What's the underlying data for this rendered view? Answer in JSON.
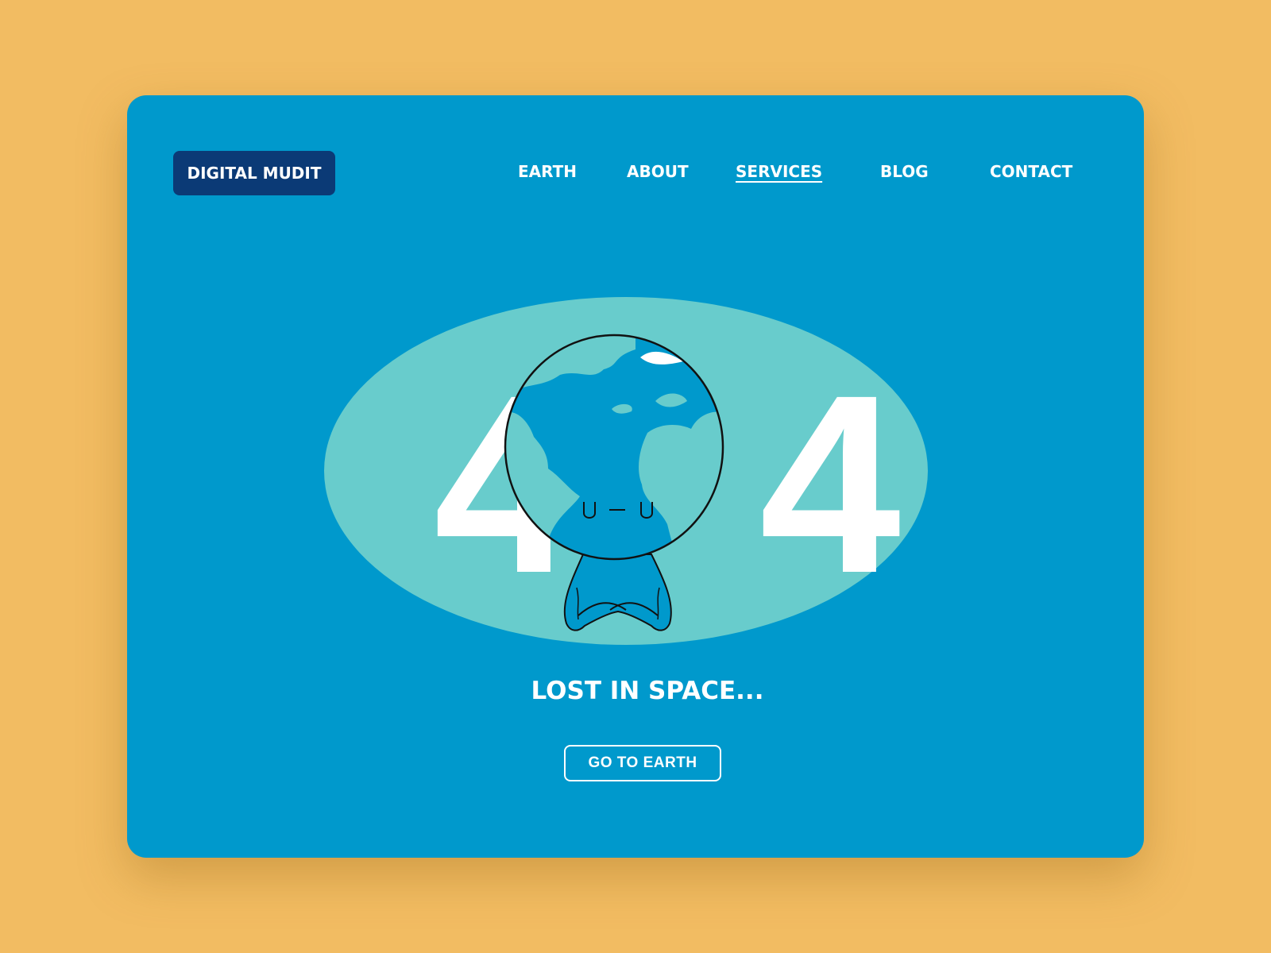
{
  "brand": {
    "logo_text": "DIGITAL MUDIT"
  },
  "nav": {
    "items": [
      {
        "label": "EARTH",
        "active": false
      },
      {
        "label": "ABOUT",
        "active": false
      },
      {
        "label": "SERVICES",
        "active": true
      },
      {
        "label": "BLOG",
        "active": false
      },
      {
        "label": "CONTACT",
        "active": false
      }
    ]
  },
  "hero": {
    "error_digit_left": "4",
    "error_digit_right": "4",
    "illustration": "earth-character-meditating",
    "face": "U — U",
    "message": "LOST IN SPACE...",
    "cta_label": "GO TO EARTH"
  },
  "colors": {
    "page_background": "#f2bc62",
    "card_background": "#0099cc",
    "ellipse": "#68cccc",
    "logo_background": "#0b3a76",
    "text": "#ffffff"
  }
}
